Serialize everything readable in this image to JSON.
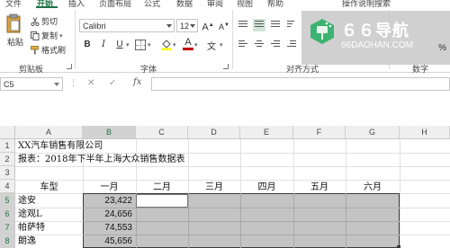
{
  "ribbon_tabs": [
    {
      "label": "文件"
    },
    {
      "label": "开始"
    },
    {
      "label": "插入"
    },
    {
      "label": "页面布局"
    },
    {
      "label": "公式"
    },
    {
      "label": "数据"
    },
    {
      "label": "审阅"
    },
    {
      "label": "视图"
    },
    {
      "label": "帮助"
    },
    {
      "label": "操作说明搜索"
    }
  ],
  "clipboard": {
    "paste": "粘贴",
    "cut": "剪切",
    "copy": "复制",
    "format_painter": "格式刷",
    "group_label": "剪贴板"
  },
  "font": {
    "font_name": "Calibri",
    "font_size": "12",
    "grow": "A",
    "shrink": "A",
    "bold": "B",
    "italic": "I",
    "underline": "U",
    "group_label": "字体",
    "font_color": "#c00000",
    "highlight_color": "#ffff00"
  },
  "alignment": {
    "group_label": "对齐方式"
  },
  "number": {
    "group_label": "数字"
  },
  "watermark": {
    "brand": "６６导航",
    "url": "66DAOHAN.COM",
    "corner": "%"
  },
  "formula_bar": {
    "name_box": "C5",
    "cancel": "✕",
    "enter": "✓",
    "fx": "fx",
    "value": ""
  },
  "columns": [
    "A",
    "B",
    "C",
    "D",
    "E",
    "F",
    "G",
    "H"
  ],
  "rows": [
    "1",
    "2",
    "3",
    "4",
    "5",
    "6",
    "7",
    "8"
  ],
  "sheet": {
    "A1": "XX汽车销售有限公司",
    "A2": "报表：2018年下半年上海大众销售数据表",
    "headers": [
      "车型",
      "一月",
      "二月",
      "三月",
      "四月",
      "五月",
      "六月"
    ],
    "data": [
      {
        "model": "途安",
        "jan": "23,422"
      },
      {
        "model": "途观L",
        "jan": "24,656"
      },
      {
        "model": "帕萨特",
        "jan": "74,553"
      },
      {
        "model": "朗逸",
        "jan": "45,656"
      }
    ]
  }
}
